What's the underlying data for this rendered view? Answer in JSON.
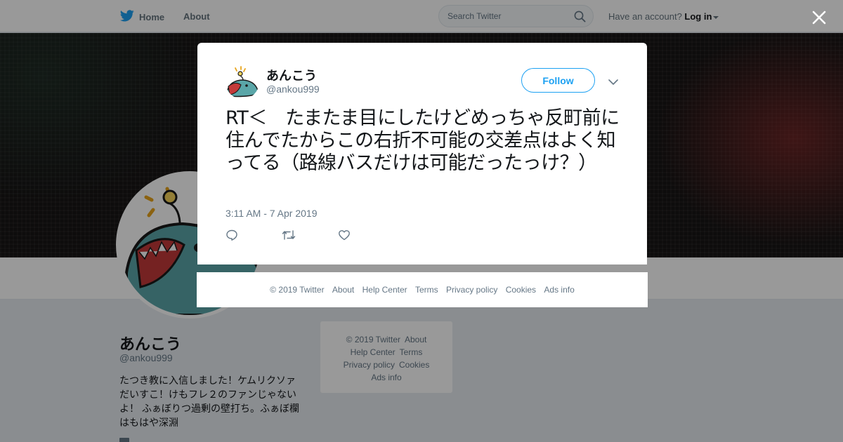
{
  "topbar": {
    "home_label": "Home",
    "about_label": "About",
    "search_placeholder": "Search Twitter",
    "account_prompt": "Have an account?",
    "login_label": "Log in"
  },
  "colors": {
    "brand_blue": "#1da1f2",
    "text_secondary": "#657786",
    "page_bg": "#e6ecf0"
  },
  "icons": {
    "brand": "twitter-bird-icon",
    "search": "search-icon",
    "close": "close-icon",
    "caret": "caret-down-icon",
    "chevron": "chevron-down-icon",
    "reply": "reply-icon",
    "retweet": "retweet-icon",
    "like": "heart-icon"
  },
  "profile": {
    "name": "あんこう",
    "handle": "@ankou999",
    "bio": "たつき教に入信しました！ケムリクソァだいすこ！けもフレ２のファンじゃないよ！ ふぁぼりつ過剰の壁打ち。ふぁぼ欄はもはや深淵"
  },
  "tweet": {
    "author_name": "あんこう",
    "author_handle": "@ankou999",
    "follow_label": "Follow",
    "text": "RT＜　たまたま目にしたけどめっちゃ反町前に住んでたからこの右折不可能の交差点はよく知ってる（路線バスだけは可能だったっけ？）",
    "timestamp": "3:11 AM - 7 Apr 2019"
  },
  "footer_links": {
    "copyright": "© 2019 Twitter",
    "about": "About",
    "help": "Help Center",
    "terms": "Terms",
    "privacy": "Privacy policy",
    "cookies": "Cookies",
    "ads": "Ads info"
  }
}
